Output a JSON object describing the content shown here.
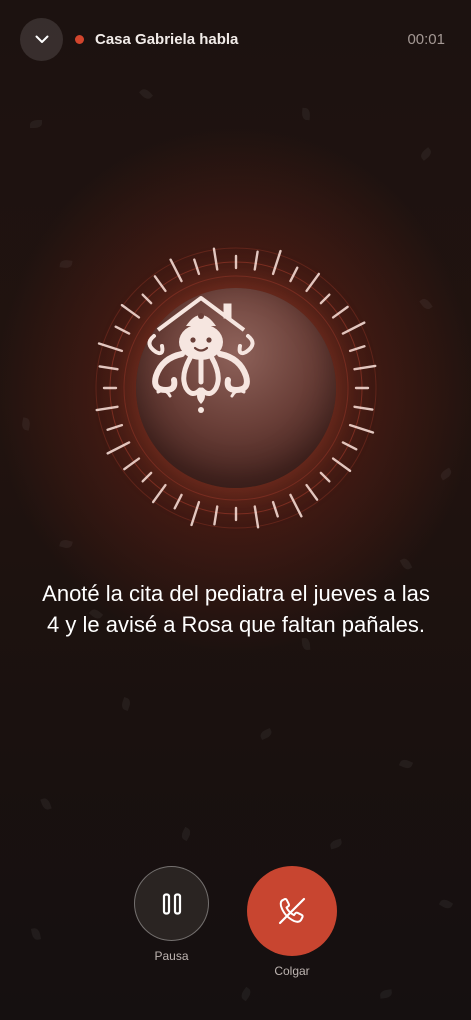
{
  "header": {
    "title": "Casa Gabriela habla",
    "timer": "00:01",
    "collapse_icon": "chevron-down-icon",
    "status_color": "#d2452d"
  },
  "avatar": {
    "icon": "octopus-house-icon",
    "glow_color": "#c44026"
  },
  "transcript": {
    "text": "Anoté la cita del pediatra el jueves a las 4 y le avisé a Rosa que faltan pañales."
  },
  "controls": {
    "pause_label": "Pausa",
    "pause_icon": "pause-icon",
    "hangup_label": "Colgar",
    "hangup_icon": "phone-hangup-icon",
    "hangup_color": "#c84530"
  }
}
